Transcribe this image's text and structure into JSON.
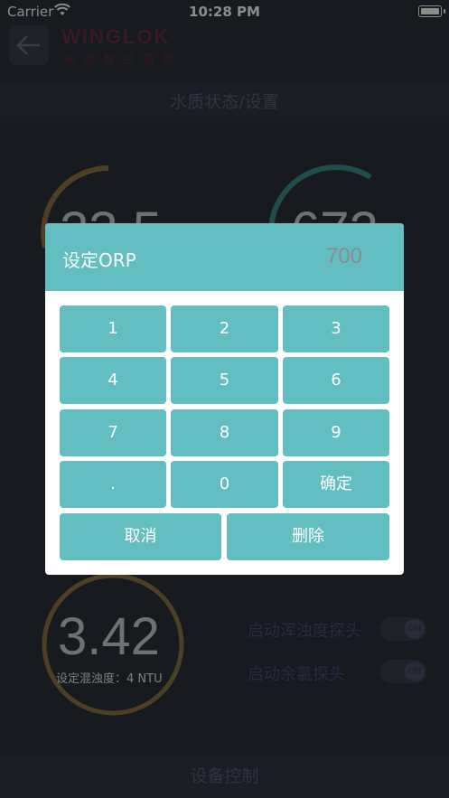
{
  "status_bar": {
    "carrier": "Carrier",
    "time": "10:28 PM"
  },
  "header": {
    "logo": "WINGLOK",
    "logo_subtitle": "泳池智控管家"
  },
  "section_top": "水质状态/设置",
  "section_bottom": "设备控制",
  "gauges": [
    {
      "value": "23.5",
      "color": "#8a7444"
    },
    {
      "value": "672",
      "color": "#3b8a8a"
    },
    {
      "value": "3.42",
      "color": "#8a7444",
      "setting": "设定混浊度：4 NTU"
    }
  ],
  "toggles": [
    {
      "label": "启动浑浊度探头",
      "state": "ON"
    },
    {
      "label": "启动余氯探头",
      "state": "ON"
    }
  ],
  "dialog": {
    "title": "设定ORP",
    "value": "700",
    "keys": [
      "1",
      "2",
      "3",
      "4",
      "5",
      "6",
      "7",
      "8",
      "9",
      ".",
      "0",
      "确定"
    ],
    "cancel": "取消",
    "delete": "删除"
  },
  "colors": {
    "accent": "#62bec0",
    "background": "#2b3039"
  }
}
